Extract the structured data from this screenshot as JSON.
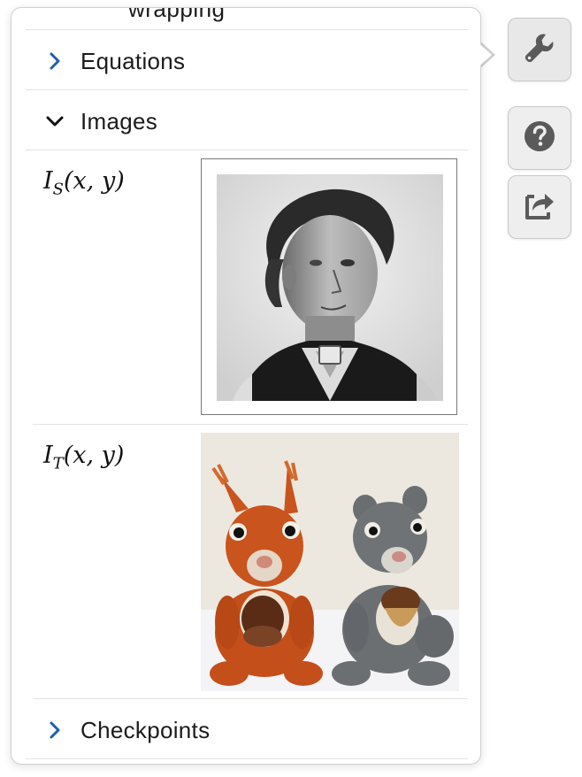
{
  "panel": {
    "partial_top_label": "wrapping",
    "sections": [
      {
        "label": "Equations",
        "expanded": false
      },
      {
        "label": "Images",
        "expanded": true
      },
      {
        "label": "Checkpoints",
        "expanded": false
      }
    ],
    "images": [
      {
        "var": "I",
        "sub": "S",
        "args": "(x, y)",
        "picture": "black-and-white portrait of a woman"
      },
      {
        "var": "I",
        "sub": "T",
        "args": "(x, y)",
        "picture": "two crocheted squirrel toys, orange and grey, holding acorns"
      }
    ]
  },
  "toolbar": {
    "buttons": [
      {
        "icon": "wrench-icon"
      },
      {
        "icon": "help-icon"
      },
      {
        "icon": "share-icon"
      }
    ]
  },
  "colors": {
    "chevron": "#1f5fa8",
    "button_bg": "#eeeeee",
    "icon": "#5a5a5a"
  }
}
